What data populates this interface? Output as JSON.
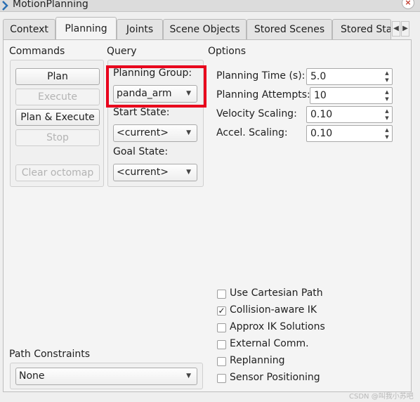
{
  "window": {
    "title": "MotionPlanning",
    "close_icon": "×"
  },
  "tabs": [
    {
      "label": "Context"
    },
    {
      "label": "Planning"
    },
    {
      "label": "Joints"
    },
    {
      "label": "Scene Objects"
    },
    {
      "label": "Stored Scenes"
    },
    {
      "label": "Stored Sta"
    }
  ],
  "tab_scroll": {
    "left": "◀",
    "right": "▶"
  },
  "commands": {
    "title": "Commands",
    "plan": "Plan",
    "execute": "Execute",
    "plan_execute": "Plan & Execute",
    "stop": "Stop",
    "clear_octomap": "Clear octomap"
  },
  "query": {
    "title": "Query",
    "planning_group_label": "Planning Group:",
    "planning_group_value": "panda_arm",
    "start_state_label": "Start State:",
    "start_state_value": "<current>",
    "goal_state_label": "Goal State:",
    "goal_state_value": "<current>"
  },
  "options": {
    "title": "Options",
    "planning_time_label": "Planning Time (s):",
    "planning_time_value": "5.0",
    "planning_attempts_label": "Planning Attempts:",
    "planning_attempts_value": "10",
    "velocity_scaling_label": "Velocity Scaling:",
    "velocity_scaling_value": "0.10",
    "accel_scaling_label": "Accel. Scaling:",
    "accel_scaling_value": "0.10",
    "checkboxes": [
      {
        "label": "Use Cartesian Path",
        "checked": false
      },
      {
        "label": "Collision-aware IK",
        "checked": true
      },
      {
        "label": "Approx IK Solutions",
        "checked": false
      },
      {
        "label": "External Comm.",
        "checked": false
      },
      {
        "label": "Replanning",
        "checked": false
      },
      {
        "label": "Sensor Positioning",
        "checked": false
      }
    ]
  },
  "path_constraints": {
    "title": "Path Constraints",
    "value": "None"
  },
  "watermark": "CSDN @叫我小苏吧",
  "colors": {
    "highlight": "#e8001c"
  }
}
